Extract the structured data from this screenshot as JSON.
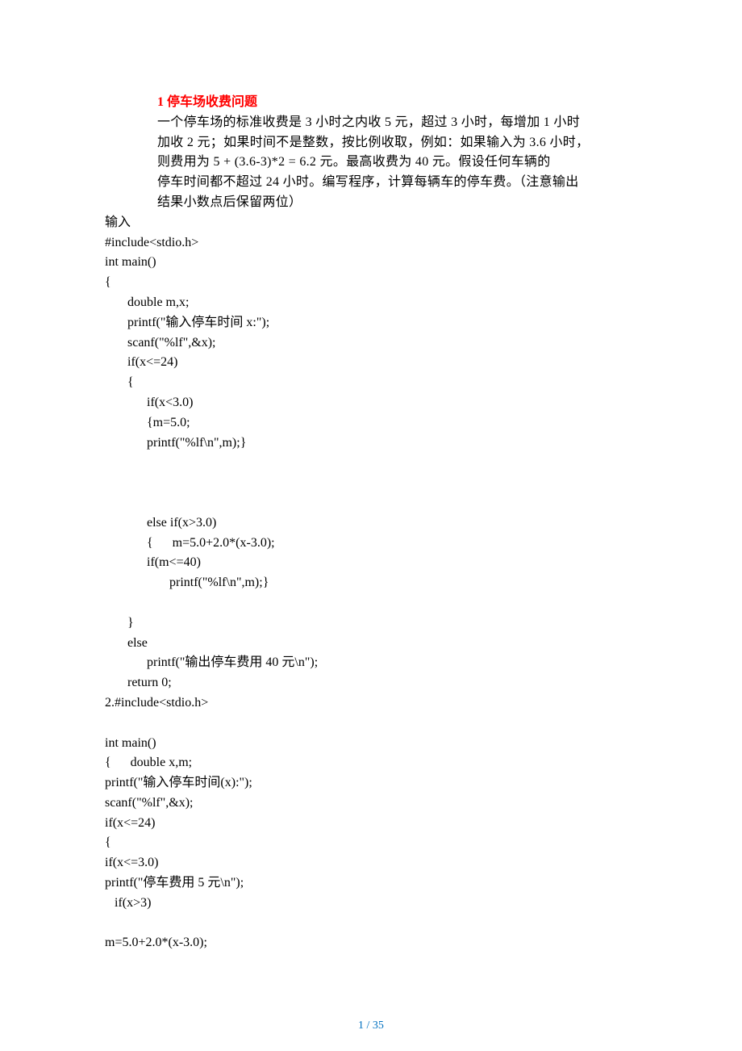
{
  "title": "1 停车场收费问题",
  "problem": {
    "l1": "一个停车场的标准收费是 3 小时之内收 5 元，超过 3 小时，每增加 1 小时",
    "l2": "加收 2 元；如果时间不是整数，按比例收取，例如：如果输入为 3.6 小时，",
    "l3": "则费用为 5 + (3.6-3)*2 = 6.2 元。最高收费为 40 元。假设任何车辆的",
    "l4": "停车时间都不超过 24 小时。编写程序，计算每辆车的停车费。（注意输出",
    "l5": "结果小数点后保留两位）"
  },
  "code1": "输入\n#include<stdio.h>\nint main()\n{\n       double m,x;\n       printf(\"输入停车时间 x:\");\n       scanf(\"%lf\",&x);\n       if(x<=24)\n       {\n             if(x<3.0)\n             {m=5.0;\n             printf(\"%lf\\n\",m);}\n\n\n\n             else if(x>3.0)\n             {      m=5.0+2.0*(x-3.0);\n             if(m<=40)\n                    printf(\"%lf\\n\",m);}\n\n       }\n       else\n             printf(\"输出停车费用 40 元\\n\");\n       return 0;\n2.#include<stdio.h>\n\nint main()\n{      double x,m;\nprintf(\"输入停车时间(x):\");\nscanf(\"%lf\",&x);\nif(x<=24)\n{\nif(x<=3.0)\nprintf(\"停车费用 5 元\\n\");\n   if(x>3)\n\nm=5.0+2.0*(x-3.0);",
  "page_num": "1 / 35"
}
